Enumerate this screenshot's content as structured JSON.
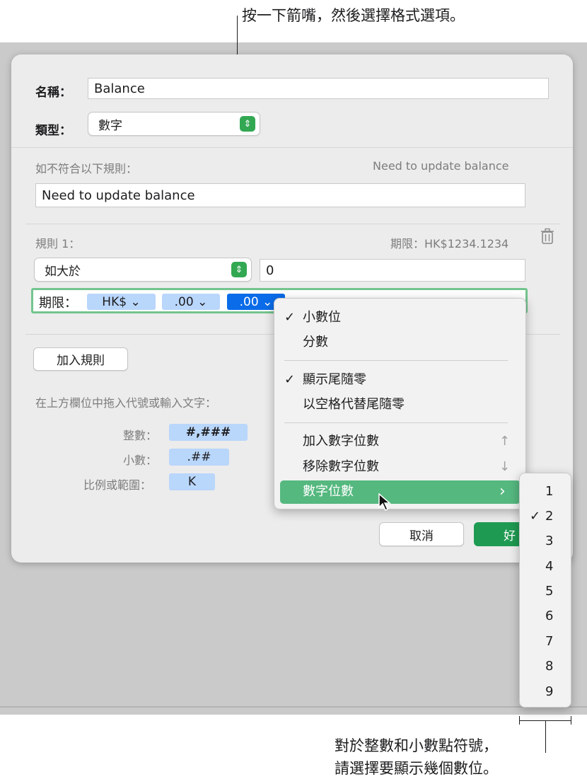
{
  "callouts": {
    "top": "按一下箭嘴，然後選擇格式選項。",
    "bottom_line1": "對於整數和小數點符號，",
    "bottom_line2": "請選擇要顯示幾個數位。"
  },
  "dialog": {
    "name_label": "名稱：",
    "name_value": "Balance",
    "type_label": "類型：",
    "type_value": "數字",
    "rule_fail_label": "如不符合以下規則：",
    "rule_fail_preview": "Need to update balance",
    "rule_fail_value": "Need to update balance",
    "rule1_label": "規則 1：",
    "rule1_preview": "期限：HK$1234.1234",
    "condition_value": "如大於",
    "condition_input": "0",
    "limit_label": "期限：",
    "tokens": [
      "HK$ ⌄",
      ".00 ⌄",
      ".00 ⌄"
    ],
    "add_rule": "加入規則",
    "drag_hint": "在上方欄位中拖入代號或輸入文字：",
    "integer_label": "整數：",
    "integer_token": "#,###",
    "decimal_label": "小數：",
    "decimal_token": ".##",
    "scale_label": "比例或範圍：",
    "scale_token": "K",
    "cancel": "取消",
    "ok": "好"
  },
  "format_menu": {
    "items": [
      {
        "check": "✓",
        "label": "小數位"
      },
      {
        "check": "",
        "label": "分數"
      },
      {
        "check": "✓",
        "label": "顯示尾隨零"
      },
      {
        "check": "",
        "label": "以空格代替尾隨零"
      },
      {
        "check": "",
        "label": "加入數字位數",
        "shortcut": "↑"
      },
      {
        "check": "",
        "label": "移除數字位數",
        "shortcut": "↓"
      },
      {
        "check": "",
        "label": "數字位數",
        "submenu": "›"
      }
    ]
  },
  "digits_submenu": {
    "selected": "2",
    "items": [
      "1",
      "2",
      "3",
      "4",
      "5",
      "6",
      "7",
      "8",
      "9"
    ],
    "check": "✓"
  },
  "colors": {
    "accent_green": "#33a853",
    "highlight_green": "#55b87f",
    "token_blue": "#b9d6fb",
    "selected_blue": "#0a6ce8"
  }
}
